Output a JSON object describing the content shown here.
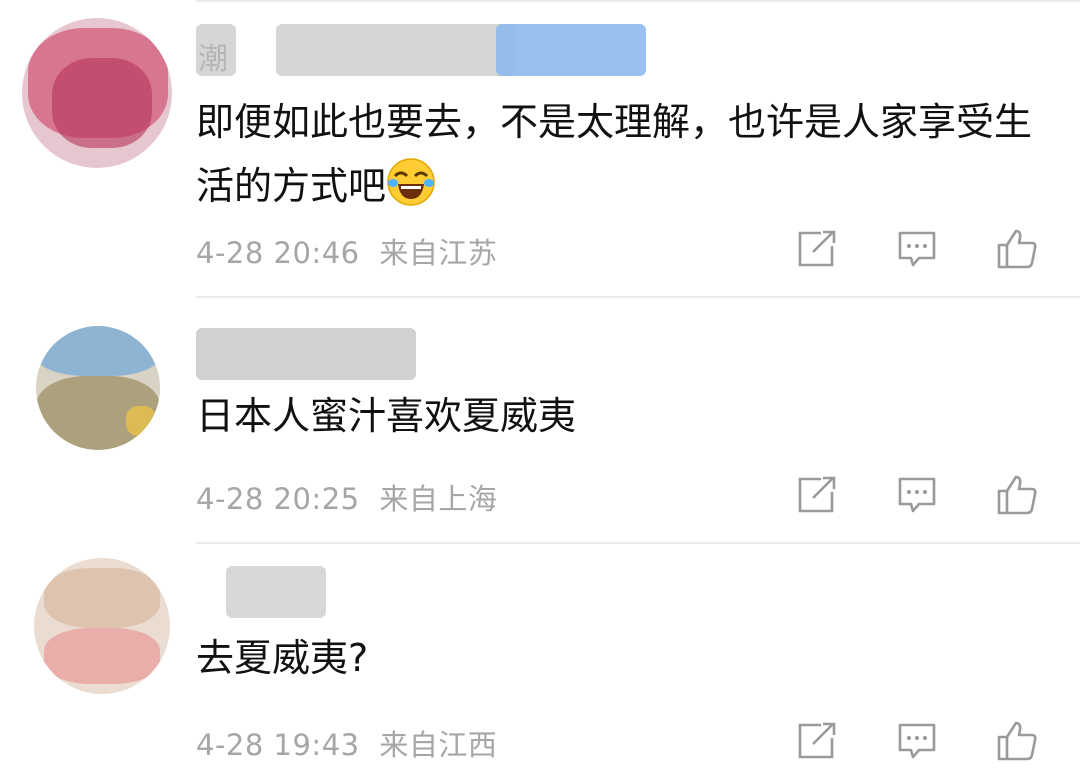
{
  "comments": [
    {
      "username": "潮",
      "text": "即便如此也要去，不是太理解，也许是人家享受生活的方式吧",
      "emoji": "tears-of-joy-emoji",
      "date": "4-28 20:46",
      "location": "来自江苏"
    },
    {
      "username": "",
      "text": "日本人蜜汁喜欢夏威夷",
      "date": "4-28 20:25",
      "location": "来自上海"
    },
    {
      "username": "",
      "text": "去夏威夷?",
      "date": "4-28 19:43",
      "location": "来自江西"
    }
  ],
  "colors": {
    "text": "#111111",
    "meta": "#a6a6a6",
    "icon": "#9a9a9a",
    "divider": "#ececec"
  },
  "icons": [
    "share-icon",
    "comment-icon",
    "like-icon"
  ]
}
